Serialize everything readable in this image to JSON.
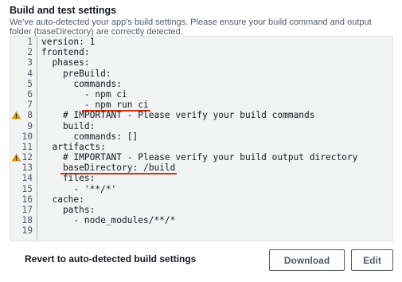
{
  "section": {
    "title": "Build and test settings",
    "description": "We've auto-detected your app's build settings. Please ensure your build command and output folder (baseDirectory) are correctly detected."
  },
  "editor": {
    "lines": [
      {
        "num": "1",
        "text": "version: 1",
        "warning": false,
        "underline": false
      },
      {
        "num": "2",
        "text": "frontend:",
        "warning": false,
        "underline": false
      },
      {
        "num": "3",
        "text": "  phases:",
        "warning": false,
        "underline": false
      },
      {
        "num": "4",
        "text": "    preBuild:",
        "warning": false,
        "underline": false
      },
      {
        "num": "5",
        "text": "      commands:",
        "warning": false,
        "underline": false
      },
      {
        "num": "6",
        "text": "        - npm ci",
        "warning": false,
        "underline": false
      },
      {
        "num": "7",
        "text": "        - npm run ci",
        "warning": false,
        "underline": true
      },
      {
        "num": "8",
        "text": "    # IMPORTANT - Please verify your build commands",
        "warning": true,
        "underline": false
      },
      {
        "num": "9",
        "text": "    build:",
        "warning": false,
        "underline": false
      },
      {
        "num": "10",
        "text": "      commands: []",
        "warning": false,
        "underline": false
      },
      {
        "num": "11",
        "text": "  artifacts:",
        "warning": false,
        "underline": false
      },
      {
        "num": "12",
        "text": "    # IMPORTANT - Please verify your build output directory",
        "warning": true,
        "underline": false
      },
      {
        "num": "13",
        "text": "    baseDirectory: /build",
        "warning": false,
        "underline": true
      },
      {
        "num": "14",
        "text": "    files:",
        "warning": false,
        "underline": false
      },
      {
        "num": "15",
        "text": "      - '**/*'",
        "warning": false,
        "underline": false
      },
      {
        "num": "16",
        "text": "  cache:",
        "warning": false,
        "underline": false
      },
      {
        "num": "17",
        "text": "    paths:",
        "warning": false,
        "underline": false
      },
      {
        "num": "18",
        "text": "      - node_modules/**/*",
        "warning": false,
        "underline": false
      },
      {
        "num": "19",
        "text": "",
        "warning": false,
        "underline": false
      }
    ],
    "warning_icon": "warning-triangle-icon",
    "warning_color": "#d4a017",
    "underline_color": "#d13212"
  },
  "footer": {
    "revert_label": "Revert to auto-detected build settings",
    "download_label": "Download",
    "edit_label": "Edit"
  }
}
